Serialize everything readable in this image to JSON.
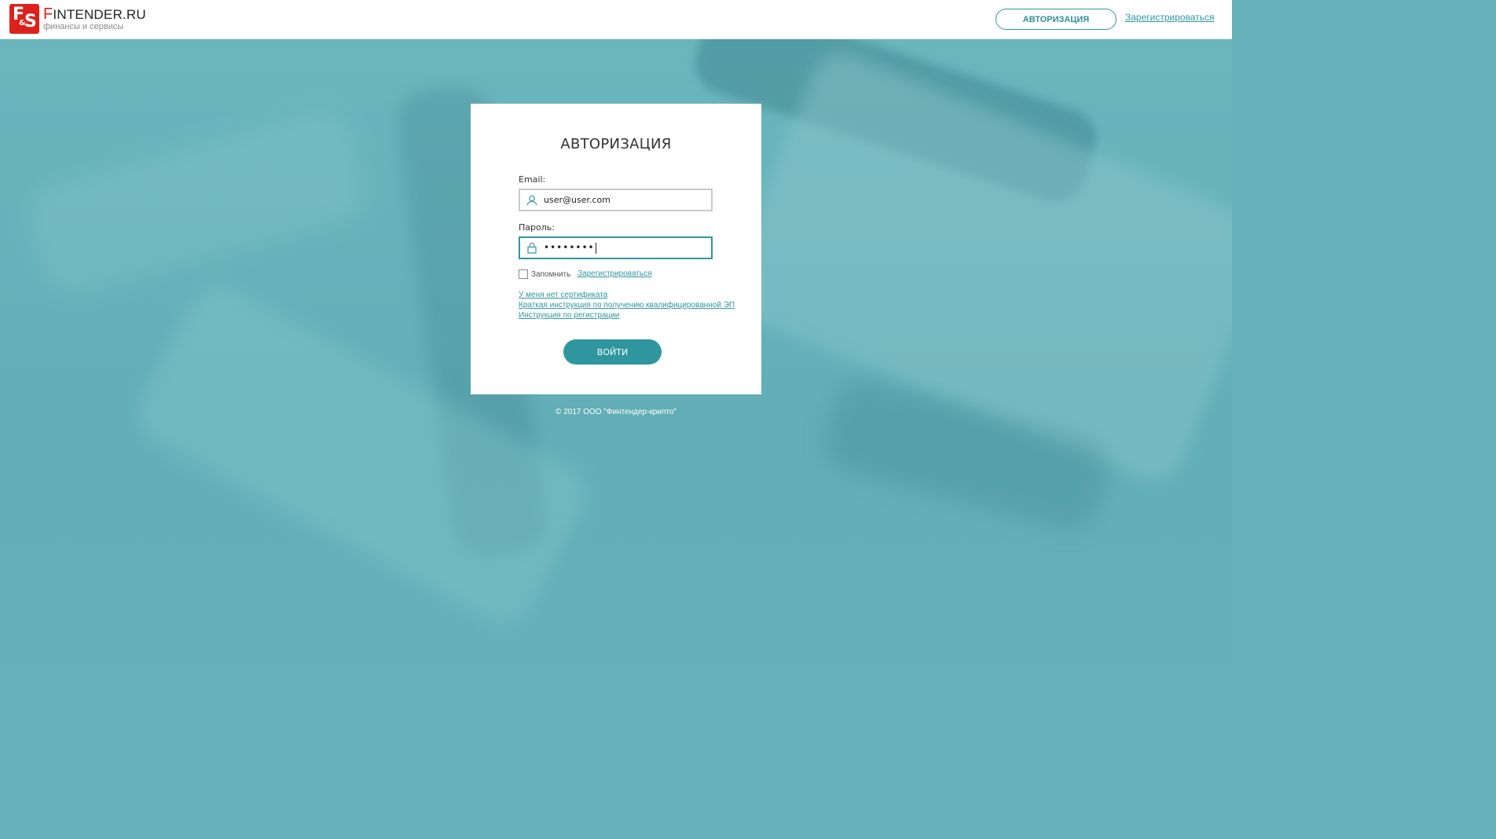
{
  "header": {
    "logo": {
      "mark_f": "F",
      "mark_amp": "&",
      "mark_s": "S",
      "title_first": "F",
      "title_rest": "INTENDER.RU",
      "subtitle": "финансы и сервисы"
    },
    "auth_button": "АВТОРИЗАЦИЯ",
    "register_link": "Зарегистрироваться"
  },
  "form": {
    "title": "АВТОРИЗАЦИЯ",
    "email_label": "Email:",
    "email_value": "user@user.com",
    "password_label": "Пароль:",
    "password_value": "••••••••",
    "remember_label": "Запомнить",
    "register_link": "Зарегистрироваться",
    "links": [
      "У меня нет сертификата",
      "Краткая инструкция по получению квалифицированной ЭП",
      "Инструкция по регистрации"
    ],
    "submit_label": "ВОЙТИ"
  },
  "footer": {
    "copyright": "© 2017 ООО \"Финтендер-крипто\""
  },
  "colors": {
    "accent": "#2f96a0",
    "brand_red": "#d9231c",
    "background": "#64b1b9"
  },
  "icons": {
    "email": "user-icon",
    "password": "lock-icon"
  }
}
